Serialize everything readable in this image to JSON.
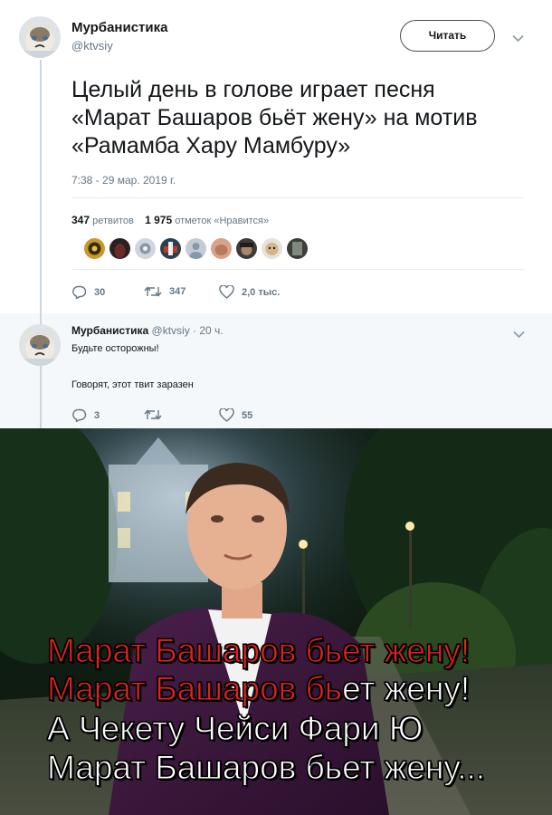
{
  "tweet": {
    "display_name": "Мурбанистика",
    "handle": "@ktvsiy",
    "follow_label": "Читать",
    "text_lines": [
      "Целый день в голове играет песня",
      "«Марат Башаров бьёт жену» на мотив",
      "«Рамамба Хару Мамбуру»"
    ],
    "timestamp": "7:38 - 29 мар. 2019 г.",
    "retweets_count": "347",
    "retweets_label": "ретвитов",
    "likes_count": "1 975",
    "likes_label": "отметок «Нравится»",
    "actions": {
      "reply_count": "30",
      "retweet_count": "347",
      "like_count": "2,0 тыс."
    }
  },
  "reply": {
    "display_name": "Мурбанистика",
    "handle_time": "@ktvsiy · 20 ч.",
    "line1": "Будьте осторожны!",
    "line2": "Говорят, этот твит заразен",
    "actions": {
      "reply_count": "3",
      "retweet_count": "",
      "like_count": "55"
    }
  },
  "meme": {
    "caption_lines": [
      {
        "red": "Марат Башаров бьет жену!",
        "white": ""
      },
      {
        "red": "Марат Башаров бь",
        "white": "ет жену!"
      },
      {
        "red": "",
        "white": "А Чекету Чейси Фари Ю"
      },
      {
        "red": "",
        "white": "Марат Башаров бьет жену..."
      }
    ]
  },
  "colors": {
    "text_primary": "#14171a",
    "text_secondary": "#657786",
    "reply_bg": "#f5f8fa",
    "caption_red": "#e0231f"
  },
  "icons": [
    "chevron-down-icon",
    "reply-icon",
    "retweet-icon",
    "like-icon"
  ]
}
